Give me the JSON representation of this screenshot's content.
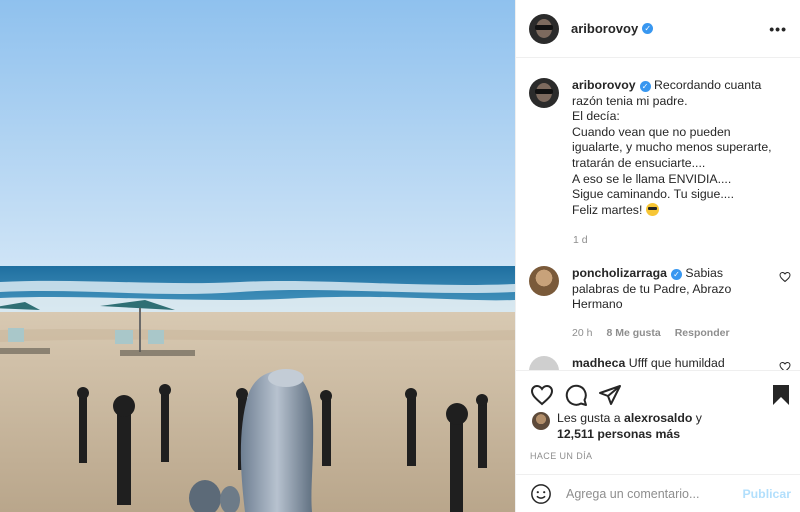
{
  "post": {
    "photo_alt": "Beach photo",
    "author": {
      "username": "ariborovoy",
      "verified_glyph": "✓"
    },
    "more_icon": "•••",
    "caption": {
      "username": "ariborovoy",
      "lines": [
        "Recordando cuanta",
        "razón tenia mi padre.",
        "El decía:",
        "Cuando vean que no pueden",
        "igualarte, y mucho menos superarte,",
        "tratarán de ensuciarte....",
        "A eso se le llama ENVIDIA....",
        "Sigue caminando. Tu sigue....",
        "Feliz martes!"
      ],
      "emoji": "sunglasses-emoji",
      "time": "1 d"
    },
    "comments": [
      {
        "username": "poncholizarraga",
        "verified": true,
        "text_lines": [
          "Sabias",
          "palabras de tu Padre, Abrazo",
          "Hermano"
        ],
        "time": "20 h",
        "likes": "8 Me gusta",
        "reply": "Responder"
      },
      {
        "username": "madheca",
        "verified": false,
        "text": "Ufff que humildad"
      }
    ],
    "likes": {
      "prefix": "Les gusta a",
      "liker": "alexrosaldo",
      "conj": "y",
      "count": "12,511 personas más"
    },
    "date": "HACE UN DÍA",
    "comment_box": {
      "placeholder": "Agrega un comentario...",
      "publish": "Publicar"
    },
    "colors": {
      "verified": "#3897f0",
      "publish_disabled": "#b2dffc",
      "meta_text": "#8e8e8e"
    }
  }
}
